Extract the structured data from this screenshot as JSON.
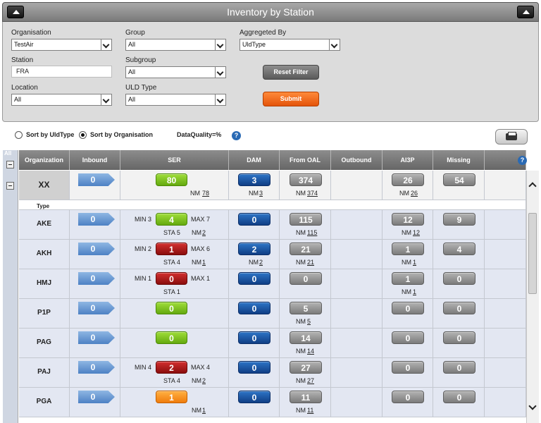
{
  "title": "Inventory by Station",
  "filters": {
    "organisation_label": "Organisation",
    "organisation_value": "TestAir",
    "group_label": "Group",
    "group_value": "All",
    "aggregated_label": "Aggregeted By",
    "aggregated_value": "UldType",
    "station_label": "Station",
    "station_value": "FRA",
    "subgroup_label": "Subgroup",
    "subgroup_value": "All",
    "location_label": "Location",
    "location_value": "All",
    "uldtype_label": "ULD Type",
    "uldtype_value": "All",
    "reset_label": "Reset Filter",
    "submit_label": "Submit"
  },
  "options": {
    "sort_uldtype": "Sort by UldType",
    "sort_org": "Sort by Organisation",
    "data_quality": "DataQuality=%",
    "help": "?"
  },
  "grid": {
    "side_all": "All",
    "help": "?",
    "type_label": "Type",
    "headers": [
      "Organization",
      "Inbound",
      "SER",
      "DAM",
      "From OAL",
      "Outbound",
      "AI3P",
      "Missing"
    ],
    "org": {
      "name": "XX",
      "inbound": "0",
      "ser": "80",
      "ser_nm_label": "NM",
      "ser_nm": "78",
      "dam": "3",
      "dam_nm_label": "NM",
      "dam_nm": "3",
      "oal": "374",
      "oal_nm_label": "NM",
      "oal_nm": "374",
      "ai3p": "26",
      "ai3p_nm_label": "NM",
      "ai3p_nm": "26",
      "missing": "54"
    },
    "rows": [
      {
        "name": "AKE",
        "inbound": "0",
        "ser": "4",
        "ser_color": "green",
        "min": "MIN 3",
        "max": "MAX 7",
        "sta": "STA 5",
        "ser_nm_label": "NM",
        "ser_nm": "2",
        "dam": "0",
        "dam_nm_label": "",
        "dam_nm": "",
        "oal": "115",
        "oal_nm_label": "NM",
        "oal_nm": "115",
        "ai3p": "12",
        "ai3p_nm_label": "NM",
        "ai3p_nm": "12",
        "missing": "9"
      },
      {
        "name": "AKH",
        "inbound": "0",
        "ser": "1",
        "ser_color": "red",
        "min": "MIN 2",
        "max": "MAX 6",
        "sta": "STA 4",
        "ser_nm_label": "NM",
        "ser_nm": "1",
        "dam": "2",
        "dam_nm_label": "NM",
        "dam_nm": "2",
        "oal": "21",
        "oal_nm_label": "NM",
        "oal_nm": "21",
        "ai3p": "1",
        "ai3p_nm_label": "NM",
        "ai3p_nm": "1",
        "missing": "4"
      },
      {
        "name": "HMJ",
        "inbound": "0",
        "ser": "0",
        "ser_color": "red",
        "min": "MIN 1",
        "max": "MAX 1",
        "sta": "STA 1",
        "ser_nm_label": "",
        "ser_nm": "",
        "dam": "0",
        "dam_nm_label": "",
        "dam_nm": "",
        "oal": "0",
        "oal_nm_label": "",
        "oal_nm": "",
        "ai3p": "1",
        "ai3p_nm_label": "NM",
        "ai3p_nm": "1",
        "missing": "0"
      },
      {
        "name": "P1P",
        "inbound": "0",
        "ser": "0",
        "ser_color": "green",
        "min": "",
        "max": "",
        "sta": "",
        "ser_nm_label": "",
        "ser_nm": "",
        "dam": "0",
        "dam_nm_label": "",
        "dam_nm": "",
        "oal": "5",
        "oal_nm_label": "NM",
        "oal_nm": "5",
        "ai3p": "0",
        "ai3p_nm_label": "",
        "ai3p_nm": "",
        "missing": "0"
      },
      {
        "name": "PAG",
        "inbound": "0",
        "ser": "0",
        "ser_color": "green",
        "min": "",
        "max": "",
        "sta": "",
        "ser_nm_label": "",
        "ser_nm": "",
        "dam": "0",
        "dam_nm_label": "",
        "dam_nm": "",
        "oal": "14",
        "oal_nm_label": "NM",
        "oal_nm": "14",
        "ai3p": "0",
        "ai3p_nm_label": "",
        "ai3p_nm": "",
        "missing": "0"
      },
      {
        "name": "PAJ",
        "inbound": "0",
        "ser": "2",
        "ser_color": "red",
        "min": "MIN 4",
        "max": "MAX 4",
        "sta": "STA 4",
        "ser_nm_label": "NM",
        "ser_nm": "2",
        "dam": "0",
        "dam_nm_label": "",
        "dam_nm": "",
        "oal": "27",
        "oal_nm_label": "NM",
        "oal_nm": "27",
        "ai3p": "0",
        "ai3p_nm_label": "",
        "ai3p_nm": "",
        "missing": "0"
      },
      {
        "name": "PGA",
        "inbound": "0",
        "ser": "1",
        "ser_color": "orange",
        "min": "",
        "max": "",
        "sta": "",
        "ser_nm_label": "NM",
        "ser_nm": "1",
        "dam": "0",
        "dam_nm_label": "",
        "dam_nm": "",
        "oal": "11",
        "oal_nm_label": "NM",
        "oal_nm": "11",
        "ai3p": "0",
        "ai3p_nm_label": "",
        "ai3p_nm": "",
        "missing": "0"
      }
    ]
  }
}
